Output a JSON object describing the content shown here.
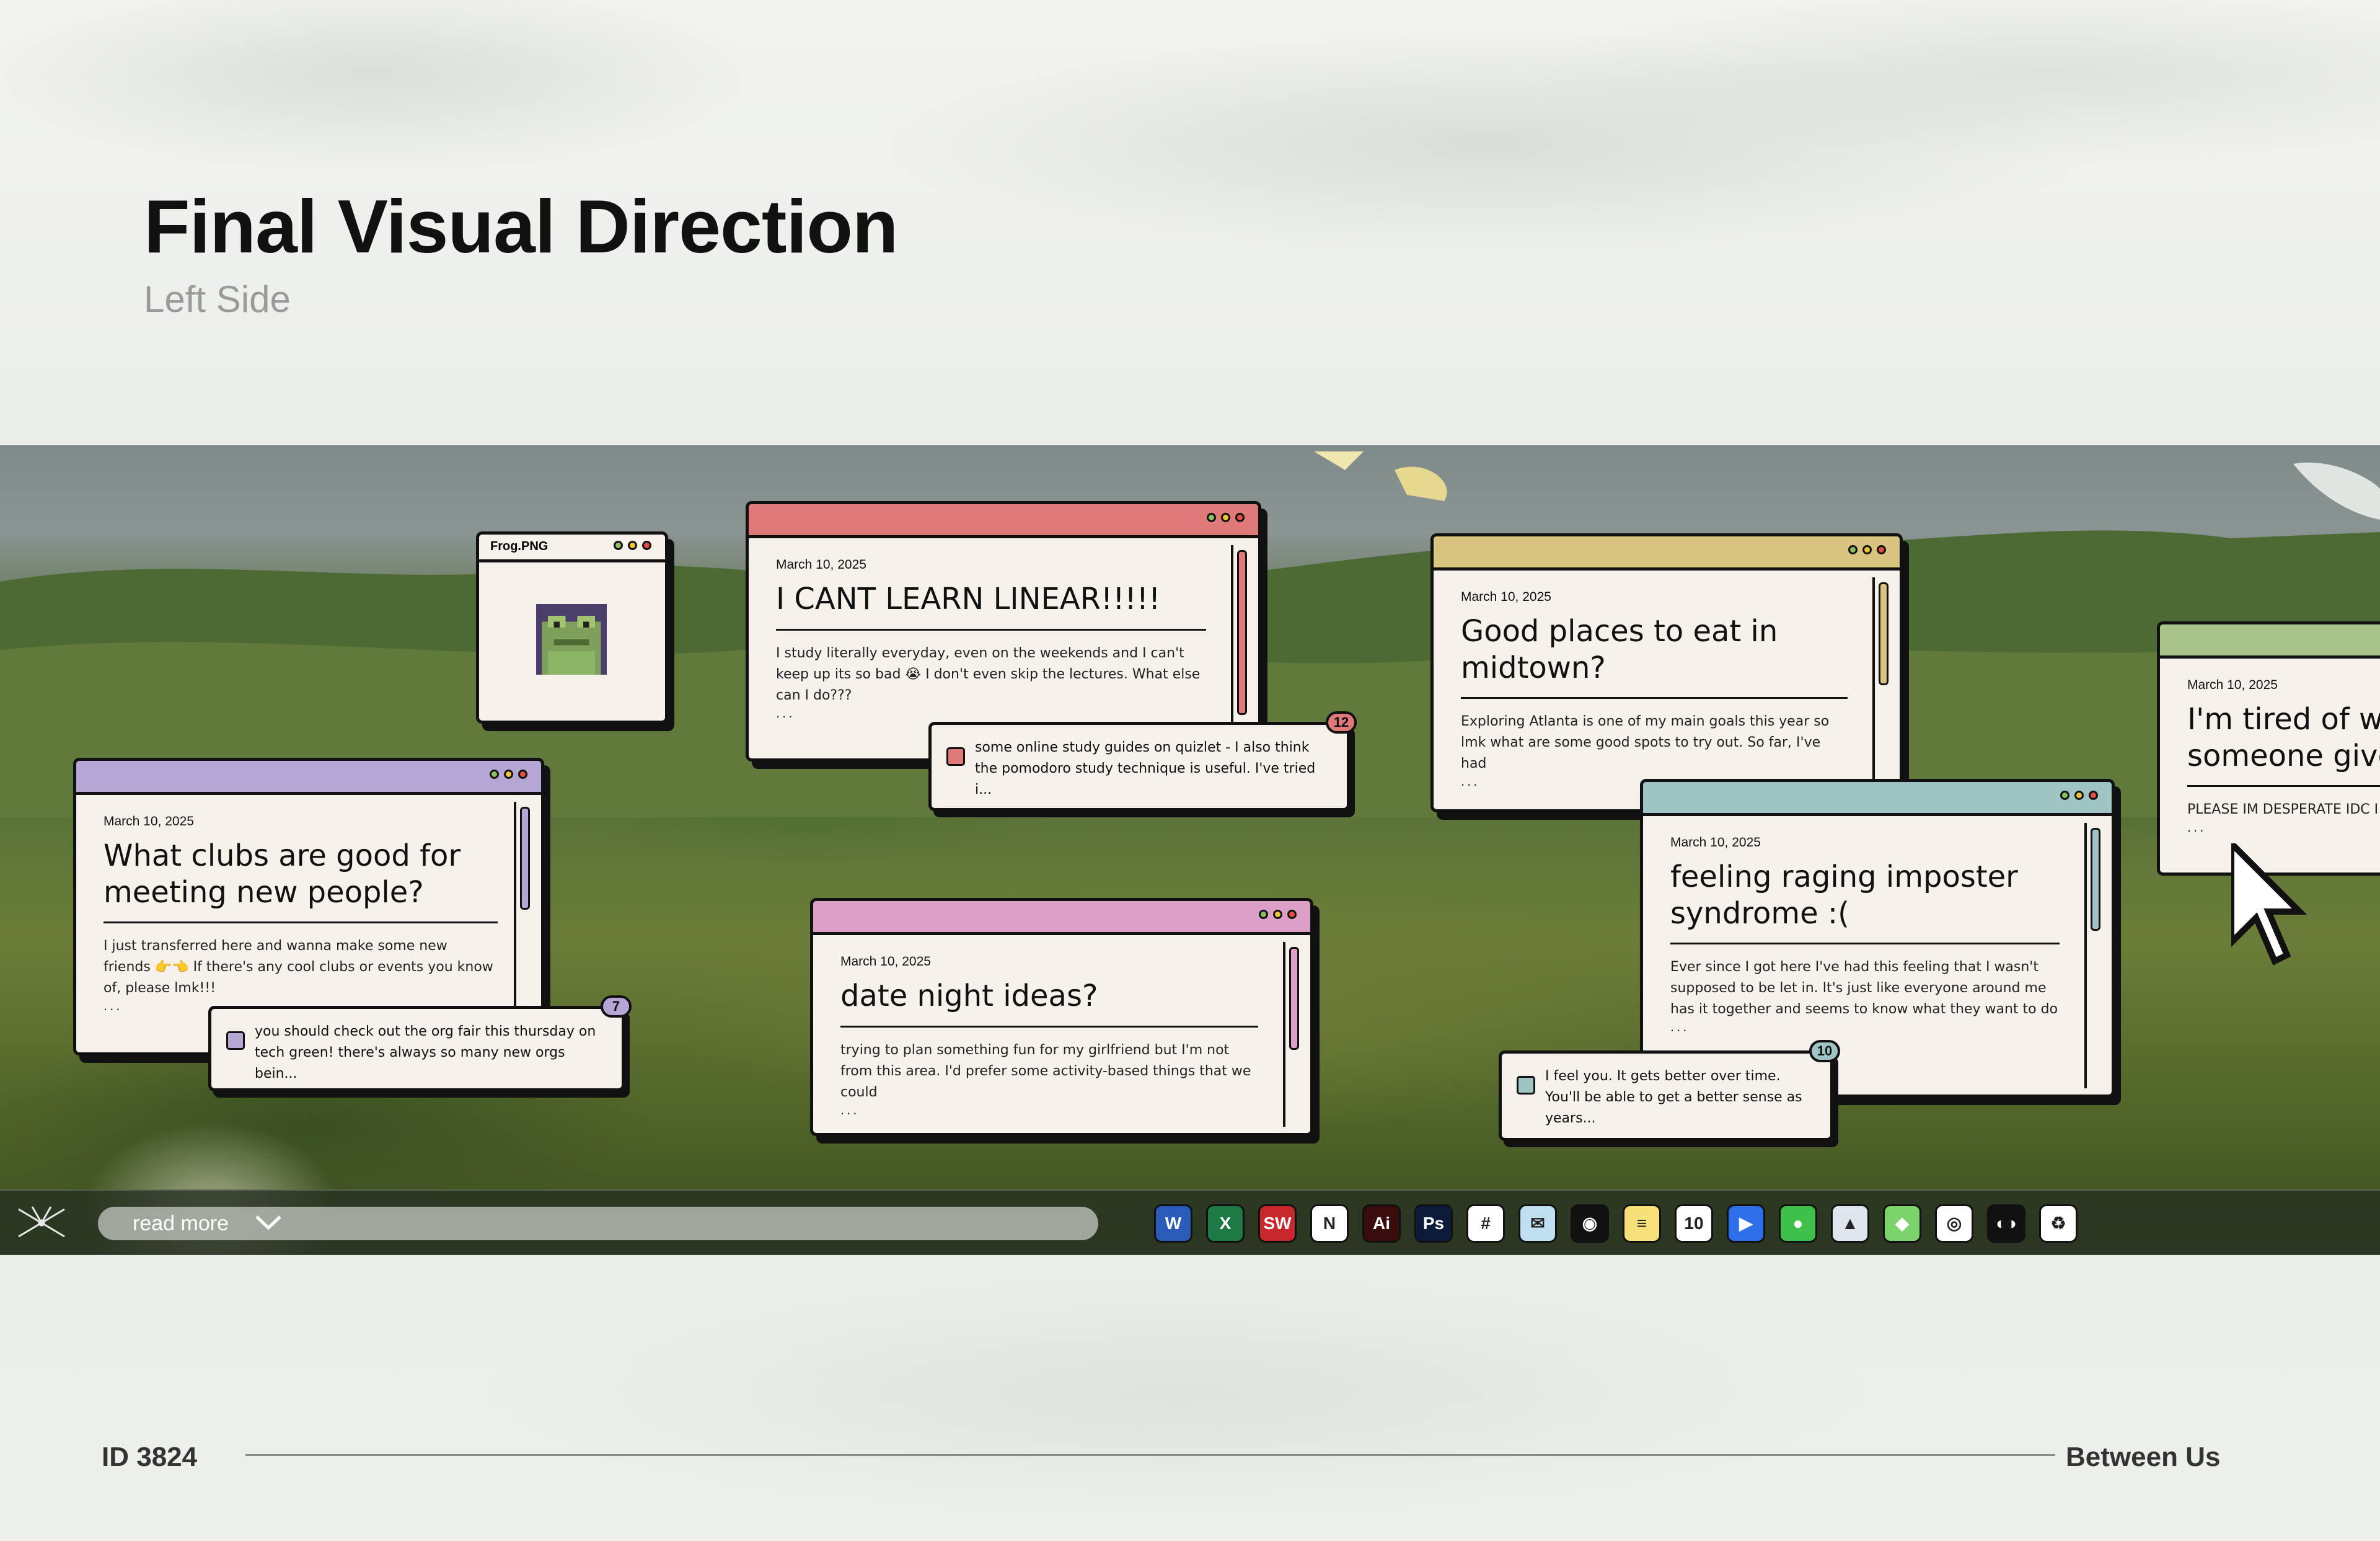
{
  "header": {
    "title": "Final Visual Direction",
    "subtitle": "Left Side"
  },
  "frog_window": {
    "title": "Frog.PNG"
  },
  "posts": [
    {
      "date": "March 10, 2025",
      "title": "What clubs are good for meeting new people?",
      "excerpt": "I just transferred here and wanna make some new friends 👉👈 If there's any cool clubs or events you know of, please lmk!!!",
      "ellipsis": "...",
      "color": "#b6a6d6",
      "reply": {
        "text": "you should check out the org fair this thursday on tech green! there's always so many new orgs bein...",
        "count": "7"
      }
    },
    {
      "date": "March 10, 2025",
      "title": "I CANT LEARN LINEAR!!!!!",
      "excerpt": "I study literally everyday, even on the weekends and I can't keep up its so bad 😭 I don't even skip the lectures. What else can I do???",
      "ellipsis": "...",
      "color": "#e07a78",
      "reply": {
        "text": "some online study guides on quizlet - I also think the pomodoro study technique is useful. I've tried i...",
        "count": "12"
      }
    },
    {
      "date": "March 10, 2025",
      "title": "date night ideas?",
      "excerpt": "trying to plan something fun for my girlfriend but I'm not from this area. I'd prefer some activity-based things that we could",
      "ellipsis": "...",
      "color": "#dca0c8"
    },
    {
      "date": "March 10, 2025",
      "title": "Good places to eat in midtown?",
      "excerpt": "Exploring Atlanta is one of my main goals this year so lmk what are some good spots to try out. So far, I've had",
      "ellipsis": "...",
      "color": "#d8c47e"
    },
    {
      "date": "March 10, 2025",
      "title": "feeling raging imposter syndrome :(",
      "excerpt": "Ever since I got here I've had this feeling that I wasn't supposed to be let in. It's just like everyone around me has it together and seems to know what they want to do",
      "ellipsis": "...",
      "color": "#9ec4c4",
      "reply": {
        "text": "I feel you. It gets better over time. You'll be able to get a better sense as years...",
        "count": "10"
      }
    },
    {
      "date": "March 10, 2025",
      "title": "I'm tired of wi someone give",
      "excerpt": "PLEASE IM DESPERATE IDC I",
      "ellipsis": "...",
      "color": "#a8c48a"
    }
  ],
  "taskbar": {
    "read_more": "read more",
    "apps": [
      {
        "name": "word",
        "glyph": "W",
        "color": "#2b5bb8"
      },
      {
        "name": "excel",
        "glyph": "X",
        "color": "#1e7a45"
      },
      {
        "name": "solidworks",
        "glyph": "SW",
        "color": "#c8282b"
      },
      {
        "name": "notion",
        "glyph": "N",
        "color": "#ffffff"
      },
      {
        "name": "illustrator",
        "glyph": "Ai",
        "color": "#3a0c0c"
      },
      {
        "name": "photoshop",
        "glyph": "Ps",
        "color": "#0c1b3a"
      },
      {
        "name": "slack",
        "glyph": "#",
        "color": "#ffffff"
      },
      {
        "name": "mail",
        "glyph": "✉",
        "color": "#bfe0f0"
      },
      {
        "name": "spotify",
        "glyph": "◉",
        "color": "#111111"
      },
      {
        "name": "notes",
        "glyph": "≡",
        "color": "#f7e07a"
      },
      {
        "name": "calendar",
        "glyph": "10",
        "color": "#ffffff"
      },
      {
        "name": "zoom",
        "glyph": "▶",
        "color": "#2d6fe8"
      },
      {
        "name": "messages",
        "glyph": "●",
        "color": "#3fc04a"
      },
      {
        "name": "photos",
        "glyph": "▲",
        "color": "#dfe6ee"
      },
      {
        "name": "maps",
        "glyph": "◆",
        "color": "#7bd36a"
      },
      {
        "name": "chrome",
        "glyph": "◎",
        "color": "#ffffff"
      },
      {
        "name": "cyberduck",
        "glyph": "◐◑",
        "color": "#111111"
      },
      {
        "name": "trash",
        "glyph": "♻",
        "color": "#ffffff"
      }
    ]
  },
  "footer": {
    "id": "ID 3824",
    "brand": "Between Us"
  }
}
